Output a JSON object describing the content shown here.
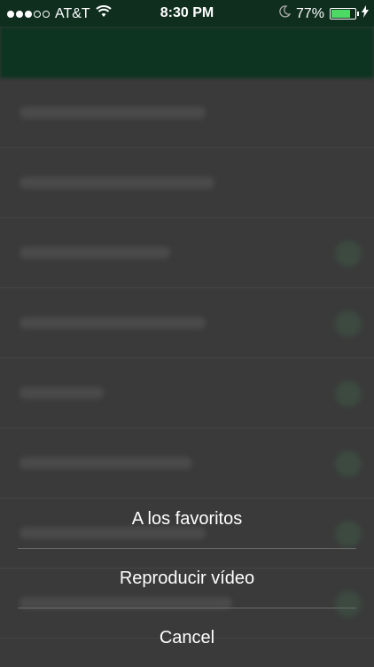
{
  "status_bar": {
    "carrier": "AT&T",
    "time": "8:30 PM",
    "battery_percent": "77%",
    "battery_level": 0.77
  },
  "list": {
    "rows": [
      {
        "has_toggle": false,
        "text_width": 210
      },
      {
        "has_toggle": false,
        "text_width": 220
      },
      {
        "has_toggle": true,
        "text_width": 170
      },
      {
        "has_toggle": true,
        "text_width": 210
      },
      {
        "has_toggle": true,
        "text_width": 95
      },
      {
        "has_toggle": true,
        "text_width": 195
      },
      {
        "has_toggle": true,
        "text_width": 210
      },
      {
        "has_toggle": true,
        "text_width": 240
      }
    ]
  },
  "action_sheet": {
    "favorites_label": "A los favoritos",
    "play_video_label": "Reproducir vídeo",
    "cancel_label": "Cancel"
  }
}
